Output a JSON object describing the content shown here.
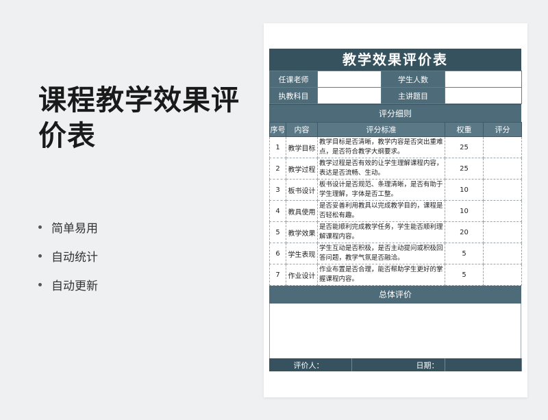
{
  "hero": {
    "title": "课程教学效果评价表",
    "features": [
      "简单易用",
      "自动统计",
      "自动更新"
    ]
  },
  "sheet": {
    "title": "教学效果评价表",
    "info": {
      "teacher_label": "任课老师",
      "students_label": "学生人数",
      "subject_label": "执教科目",
      "topic_label": "主讲题目"
    },
    "detail_heading": "评分细则",
    "columns": [
      "序号",
      "内容",
      "评分标准",
      "权重",
      "评分"
    ],
    "rows": [
      {
        "no": "1",
        "item": "教学目标",
        "criteria": "教学目标是否清晰，教学内容是否突出重难点，是否符合教学大纲要求。",
        "weight": "25",
        "score": ""
      },
      {
        "no": "2",
        "item": "教学过程",
        "criteria": "教学过程是否有效的让学生理解课程内容，表达是否流畅、生动。",
        "weight": "25",
        "score": ""
      },
      {
        "no": "3",
        "item": "板书设计",
        "criteria": "板书设计是否规范、条理清晰，是否有助于学生理解，字体是否工整。",
        "weight": "10",
        "score": ""
      },
      {
        "no": "4",
        "item": "教具使用",
        "criteria": "是否妥善利用教具以完成教学目的，课程是否轻松有趣。",
        "weight": "10",
        "score": ""
      },
      {
        "no": "5",
        "item": "教学效果",
        "criteria": "是否能顺利完成教学任务，学生能否顺利理解课程内容。",
        "weight": "20",
        "score": ""
      },
      {
        "no": "6",
        "item": "学生表现",
        "criteria": "学生互动是否积极，是否主动提问或积极回答问题，教学气氛是否融洽。",
        "weight": "5",
        "score": ""
      },
      {
        "no": "7",
        "item": "作业设计",
        "criteria": "作业布置是否合理，能否帮助学生更好的掌握课程内容。",
        "weight": "5",
        "score": ""
      }
    ],
    "summary_heading": "总体评价",
    "footer": {
      "evaluator_label": "评价人：",
      "date_label": "日期："
    }
  },
  "colors": {
    "dark_header": "#35525e",
    "mid_header": "#4d6b78",
    "column_header": "#5a7886"
  }
}
